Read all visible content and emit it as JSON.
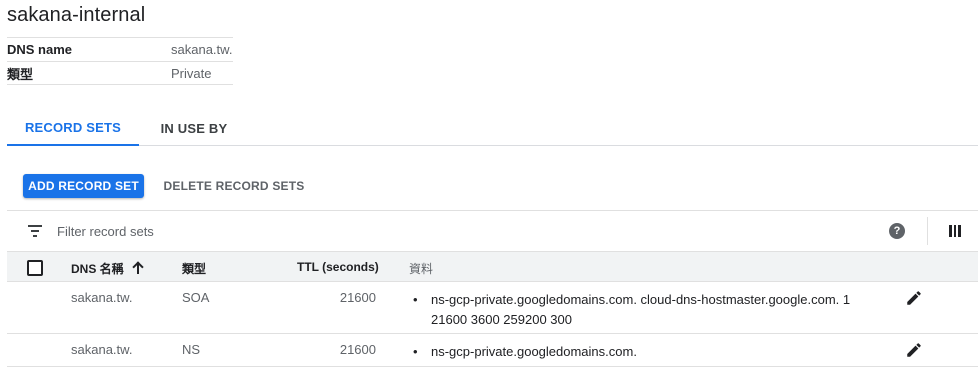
{
  "page": {
    "title": "sakana-internal"
  },
  "info": [
    {
      "key": "DNS name",
      "value": "sakana.tw."
    },
    {
      "key": "類型",
      "value": "Private"
    }
  ],
  "tabs": [
    {
      "label": "RECORD SETS",
      "active": true
    },
    {
      "label": "IN USE BY",
      "active": false
    }
  ],
  "actions": {
    "add_label": "ADD RECORD SET",
    "delete_label": "DELETE RECORD SETS"
  },
  "filter": {
    "placeholder": "Filter record sets",
    "icon": "filter-icon",
    "help_icon": "help-icon",
    "columns_icon": "view-columns-icon"
  },
  "table": {
    "headers": {
      "name": "DNS 名稱",
      "type": "類型",
      "ttl": "TTL (seconds)",
      "data": "資料"
    },
    "sort_icon": "arrow-upward-icon",
    "rows": [
      {
        "name": "sakana.tw.",
        "type": "SOA",
        "ttl": "21600",
        "data": "ns-gcp-private.googledomains.com. cloud-dns-hostmaster.google.com. 1 21600 3600 259200 300"
      },
      {
        "name": "sakana.tw.",
        "type": "NS",
        "ttl": "21600",
        "data": "ns-gcp-private.googledomains.com."
      }
    ]
  },
  "colors": {
    "accent": "#1a73e8",
    "text": "#202124",
    "muted": "#5f6368",
    "border": "#e0e0e0",
    "header_bg": "#f1f3f4"
  }
}
